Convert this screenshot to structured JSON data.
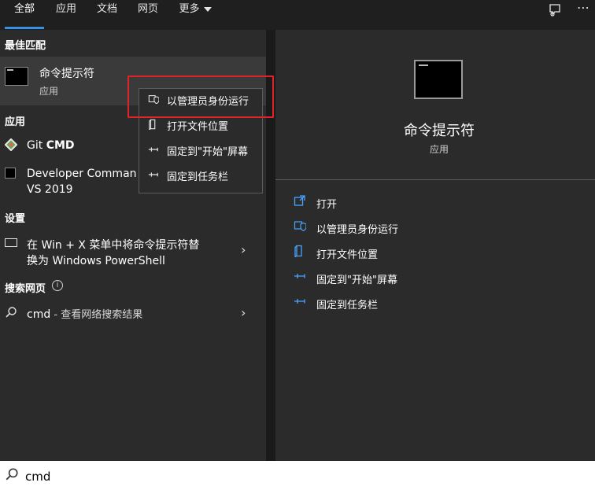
{
  "tabs": {
    "all": "全部",
    "apps": "应用",
    "docs": "文档",
    "web": "网页",
    "more": "更多"
  },
  "icons": {
    "feedback": "feedback-icon",
    "more_options": "ellipsis-icon"
  },
  "left": {
    "best_match_label": "最佳匹配",
    "best_match": {
      "title": "命令提示符",
      "subtitle": "应用"
    },
    "apps_label": "应用",
    "apps": [
      {
        "title_plain": "Git ",
        "title_bold": "CMD"
      },
      {
        "title_line1": "Developer Comman",
        "title_line2": "VS 2019"
      }
    ],
    "settings_label": "设置",
    "setting_item": {
      "line1": "在 Win + X 菜单中将命令提示符替",
      "line2": "换为 Windows PowerShell"
    },
    "web_label": "搜索网页",
    "web_item": {
      "query": "cmd",
      "suffix": " - 查看网络搜索结果"
    }
  },
  "context_menu": {
    "items": [
      "以管理员身份运行",
      "打开文件位置",
      "固定到\"开始\"屏幕",
      "固定到任务栏"
    ]
  },
  "right": {
    "title": "命令提示符",
    "subtitle": "应用",
    "actions": [
      "打开",
      "以管理员身份运行",
      "打开文件位置",
      "固定到\"开始\"屏幕",
      "固定到任务栏"
    ]
  },
  "search": {
    "value": "cmd"
  },
  "colors": {
    "accent": "#3b8fe0",
    "highlight_box": "#e0232a",
    "action_icon": "#4aa3ff"
  }
}
